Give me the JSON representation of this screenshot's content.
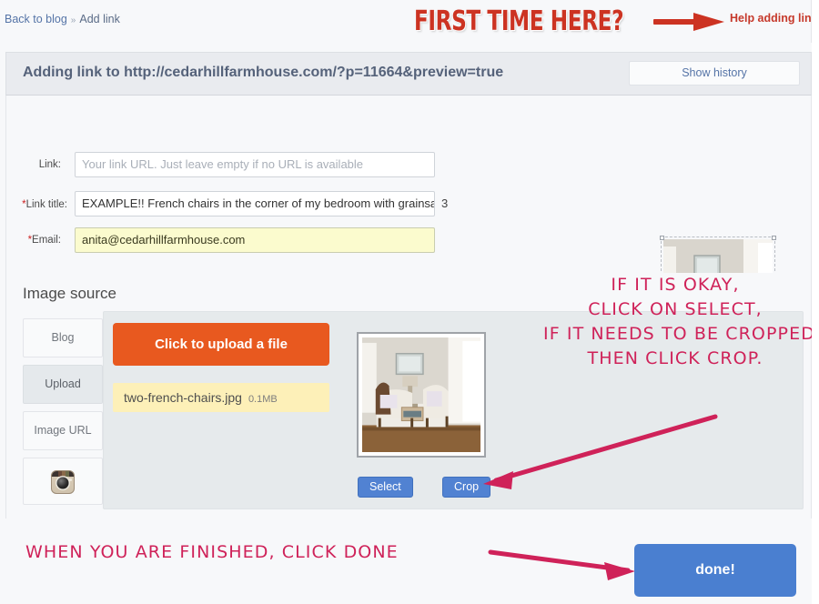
{
  "breadcrumb": {
    "back_label": "Back to blog",
    "separator": "»",
    "current": "Add link"
  },
  "banner": {
    "headline": "FIRST TIME HERE?",
    "help_link": "Help adding links",
    "arrow_icon": "right-arrow-icon",
    "headline_color": "#cc3322",
    "help_color": "#c6392b"
  },
  "header": {
    "title": "Adding link to http://cedarhillfarmhouse.com/?p=11664&preview=true",
    "show_history_label": "Show history"
  },
  "form": {
    "link": {
      "label": "Link:",
      "value": "",
      "placeholder": "Your link URL. Just leave empty if no URL is available",
      "required": false
    },
    "link_title": {
      "label": "Link title:",
      "value": "EXAMPLE!! French chairs in the corner of my bedroom with grainsack fa",
      "placeholder": "",
      "required": true,
      "required_marker": "*",
      "counter": "3"
    },
    "email": {
      "label": "Email:",
      "value": "anita@cedarhillfarmhouse.com",
      "placeholder": "",
      "required": true,
      "required_marker": "*"
    }
  },
  "thumbnail": {
    "alt": "two french chairs in bedroom corner",
    "crop_selection": true
  },
  "image_source": {
    "section_title": "Image source",
    "tabs": [
      {
        "label": "Blog",
        "name": "tab-blog",
        "active": false
      },
      {
        "label": "Upload",
        "name": "tab-upload",
        "active": true
      },
      {
        "label": "Image URL",
        "name": "tab-image-url",
        "active": false
      },
      {
        "label": "",
        "name": "tab-instagram",
        "icon": "instagram-icon",
        "active": false
      }
    ],
    "upload": {
      "upload_button_label": "Click to upload a file",
      "upload_button_color": "#e8591f",
      "file_name": "two-french-chairs.jpg",
      "file_size": "0.1MB",
      "select_button_label": "Select",
      "crop_button_label": "Crop",
      "button_color": "#5182d2"
    }
  },
  "annotations": {
    "color": "#cf2259",
    "crop_instructions": [
      "IF IT IS OKAY,",
      "CLICK ON SELECT,",
      "IF IT NEEDS TO BE CROPPED,",
      "THEN CLICK CROP."
    ],
    "done_instruction": "WHEN YOU ARE FINISHED, CLICK DONE"
  },
  "footer": {
    "done_label": "done!",
    "done_color": "#4a7fd0"
  }
}
